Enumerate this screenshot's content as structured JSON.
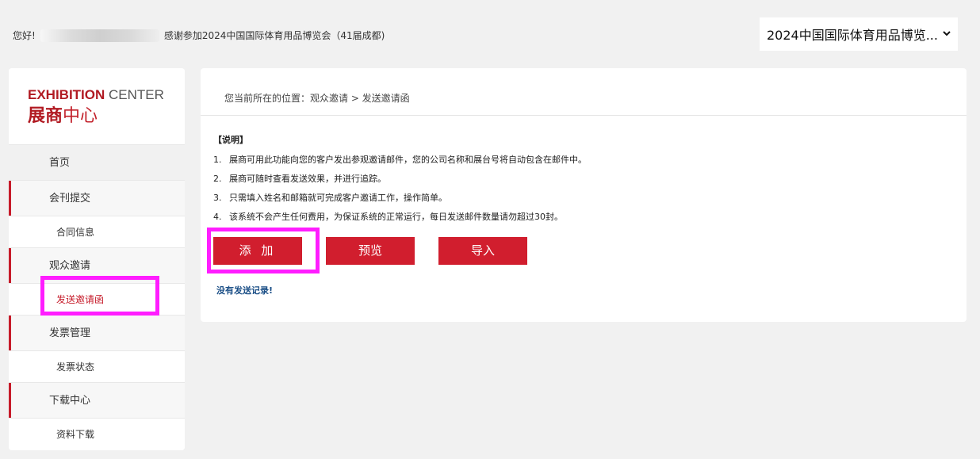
{
  "header": {
    "greeting": "您好!",
    "thanks": "感谢参加2024中国国际体育用品博览会（41届成都)",
    "expo_select_value": "2024中国国际体育用品博览..."
  },
  "sidebar": {
    "brand_en_bold": "EXHIBITION",
    "brand_en_light": " CENTER",
    "brand_cn_bold": "展商",
    "brand_cn_light": "中心",
    "items": [
      {
        "label": "首页"
      },
      {
        "label": "会刊提交"
      },
      {
        "label": "合同信息"
      },
      {
        "label": "观众邀请"
      },
      {
        "label": "发送邀请函"
      },
      {
        "label": "发票管理"
      },
      {
        "label": "发票状态"
      },
      {
        "label": "下载中心"
      },
      {
        "label": "资料下载"
      }
    ]
  },
  "main": {
    "breadcrumb": "您当前所在的位置：观众邀请 > 发送邀请函",
    "notes_title": "【说明】",
    "notes": [
      {
        "num": "1.",
        "text": "展商可用此功能向您的客户发出参观邀请邮件，您的公司名称和展台号将自动包含在邮件中。"
      },
      {
        "num": "2.",
        "text": "展商可随时查看发送效果，并进行追踪。"
      },
      {
        "num": "3.",
        "text": "只需填入姓名和邮箱就可完成客户邀请工作，操作简单。"
      },
      {
        "num": "4.",
        "text": "该系统不会产生任何费用，为保证系统的正常运行，每日发送邮件数量请勿超过30封。"
      }
    ],
    "buttons": {
      "add": "添 加",
      "preview": "预览",
      "import": "导入"
    },
    "no_record": "没有发送记录!"
  },
  "colors": {
    "accent": "#d11e2e",
    "highlight": "#ff1dff",
    "link": "#1a4e86"
  }
}
